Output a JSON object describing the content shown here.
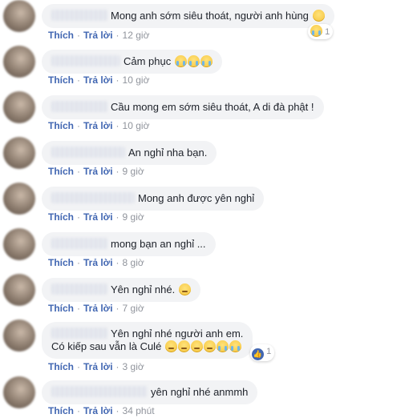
{
  "actions": {
    "like": "Thích",
    "reply": "Trả lời",
    "separator": "·"
  },
  "comments": [
    {
      "text": "Mong anh sớm siêu thoát, người anh hùng",
      "emojis": [
        "smile"
      ],
      "time": "12 giờ",
      "reaction_count": "1",
      "reaction_icon": "sad-face-icon"
    },
    {
      "text": "Cảm phục",
      "emojis": [
        "cry",
        "cry",
        "cry"
      ],
      "time": "10 giờ"
    },
    {
      "text": "Cầu mong em sớm siêu thoát, A di đà phật !",
      "emojis": [],
      "time": "10 giờ"
    },
    {
      "text": "An nghỉ nha bạn.",
      "emojis": [],
      "time": "9 giờ"
    },
    {
      "text": "Mong anh được yên nghỉ",
      "emojis": [],
      "time": "9 giờ"
    },
    {
      "text": "mong bạn an nghỉ ...",
      "emojis": [],
      "time": "8 giờ"
    },
    {
      "text": "Yên nghỉ nhé.",
      "emojis": [
        "relieved"
      ],
      "time": "7 giờ"
    },
    {
      "text": "Yên nghỉ nhé người anh em.",
      "text2": "Có kiếp sau vẫn là Culé",
      "emojis": [
        "relieved",
        "relieved",
        "relieved",
        "relieved",
        "cry",
        "cry"
      ],
      "time": "3 giờ",
      "reaction_count": "1",
      "reaction_icon": "like-icon"
    },
    {
      "text": "yên nghỉ nhé anmmh",
      "emojis": [],
      "time": "34 phút"
    }
  ]
}
